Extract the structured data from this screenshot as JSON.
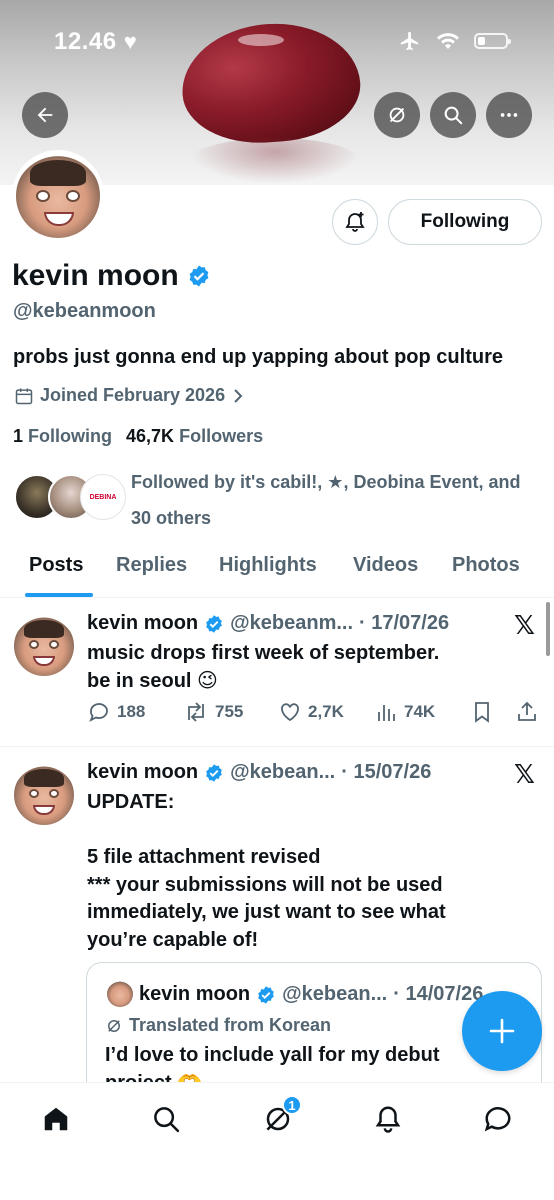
{
  "status_bar": {
    "time": "12.46"
  },
  "profile": {
    "name": "kevin moon",
    "handle": "@kebeanmoon",
    "bio": "probs just gonna end up yapping about pop culture",
    "joined": "Joined February 2026",
    "following_count": "1",
    "following_label": "Following",
    "followers_count": "46,7K",
    "followers_label": "Followers",
    "followed_by": "Followed by it's cabil!, ★, Deobina Event, and 30 others",
    "follow_button": "Following"
  },
  "tabs": [
    {
      "label": "Posts"
    },
    {
      "label": "Replies"
    },
    {
      "label": "Highlights"
    },
    {
      "label": "Videos"
    },
    {
      "label": "Photos"
    }
  ],
  "posts": [
    {
      "name": "kevin moon",
      "handle": "@kebeanm...",
      "date": "· 17/07/26",
      "text": "music drops first week of september. be in seoul 😉",
      "replies": "188",
      "reposts": "755",
      "likes": "2,7K",
      "views": "74K"
    },
    {
      "name": "kevin moon",
      "handle": "@kebean...",
      "date": "· 15/07/26",
      "text_lines": [
        "UPDATE:",
        "",
        "5 file attachment revised",
        "*** your submissions will not be used",
        "immediately, we just want to see what",
        "you’re capable of!"
      ],
      "quote": {
        "name": "kevin moon",
        "handle": "@kebean...",
        "date": "· 14/07/26",
        "translated": "Translated from Korean",
        "text_line1": "I’d love to include yall for my debut",
        "text_line2": "project 🫶"
      }
    }
  ],
  "avatar_badge_text": "DEBINA",
  "bottom_nav": {
    "messages_badge": "1"
  },
  "colors": {
    "accent": "#1d9bf0",
    "text": "#0f1419",
    "secondary": "#536471"
  },
  "icons": [
    "back-arrow-icon",
    "grok-icon",
    "search-icon",
    "more-icon",
    "bell-plus-icon",
    "verified-icon",
    "calendar-icon",
    "chevron-right-icon",
    "reply-icon",
    "repost-icon",
    "like-icon",
    "views-icon",
    "bookmark-icon",
    "share-icon",
    "x-logo-icon",
    "plus-icon",
    "home-icon",
    "notifications-icon",
    "messages-icon"
  ]
}
